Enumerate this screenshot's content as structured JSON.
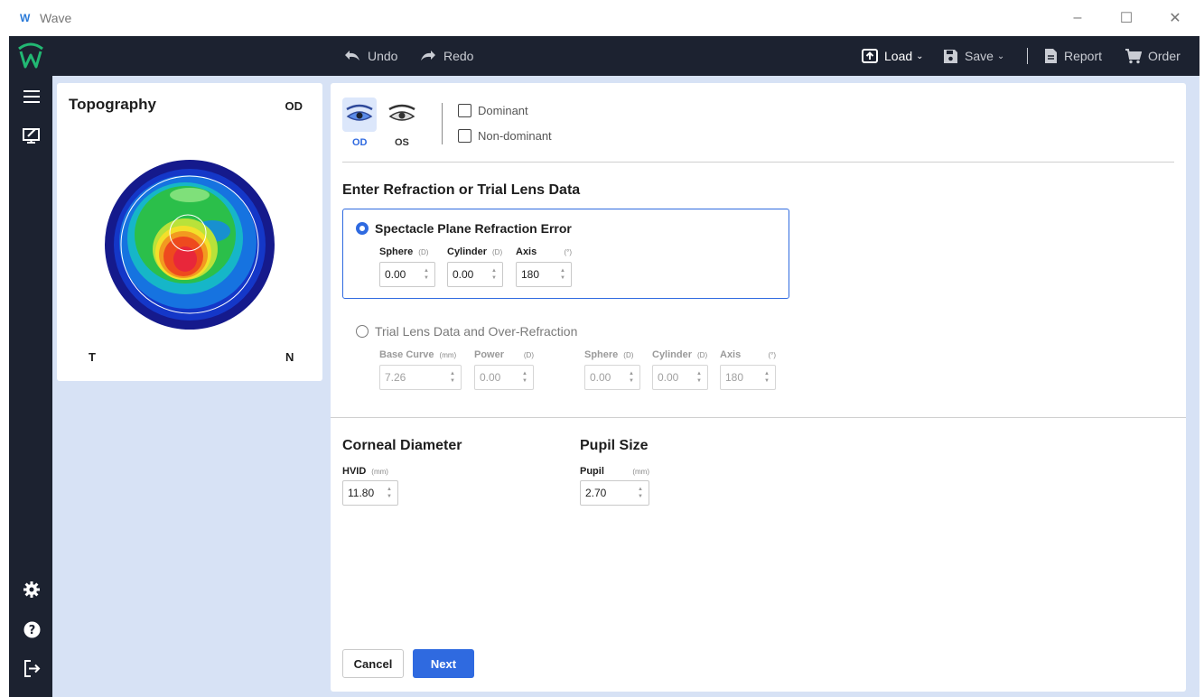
{
  "window": {
    "title": "Wave",
    "minimize": "–",
    "maximize": "☐",
    "close": "✕"
  },
  "toolbar": {
    "undo": "Undo",
    "redo": "Redo",
    "load": "Load",
    "save": "Save",
    "report": "Report",
    "order": "Order"
  },
  "sidebar": {
    "icons": [
      "menu-icon",
      "monitor-edit-icon",
      "gear-icon",
      "help-icon",
      "logout-icon"
    ]
  },
  "topography": {
    "title": "Topography",
    "eye": "OD",
    "left_label": "T",
    "right_label": "N"
  },
  "eye_select": {
    "od": "OD",
    "os": "OS",
    "selected": "OD"
  },
  "dominance": {
    "dominant": "Dominant",
    "non_dominant": "Non-dominant"
  },
  "refraction": {
    "heading": "Enter Refraction or Trial Lens Data",
    "spectacle": {
      "label": "Spectacle Plane Refraction Error",
      "sphere_label": "Sphere",
      "sphere_unit": "(D)",
      "sphere": "0.00",
      "cylinder_label": "Cylinder",
      "cylinder_unit": "(D)",
      "cylinder": "0.00",
      "axis_label": "Axis",
      "axis_unit": "(°)",
      "axis": "180"
    },
    "trial": {
      "label": "Trial Lens Data and Over-Refraction",
      "base_curve_label": "Base Curve",
      "base_curve_unit": "(mm)",
      "base_curve": "7.26",
      "power_label": "Power",
      "power_unit": "(D)",
      "power": "0.00",
      "sphere_label": "Sphere",
      "sphere_unit": "(D)",
      "sphere": "0.00",
      "cylinder_label": "Cylinder",
      "cylinder_unit": "(D)",
      "cylinder": "0.00",
      "axis_label": "Axis",
      "axis_unit": "(°)",
      "axis": "180"
    }
  },
  "corneal": {
    "heading": "Corneal Diameter",
    "hvid_label": "HVID",
    "hvid_unit": "(mm)",
    "hvid": "11.80"
  },
  "pupil": {
    "heading": "Pupil Size",
    "pupil_label": "Pupil",
    "pupil_unit": "(mm)",
    "pupil": "2.70"
  },
  "actions": {
    "cancel": "Cancel",
    "next": "Next"
  },
  "colors": {
    "accent": "#2f6ae0",
    "nav": "#1c2230",
    "content_bg": "#d7e2f5"
  }
}
